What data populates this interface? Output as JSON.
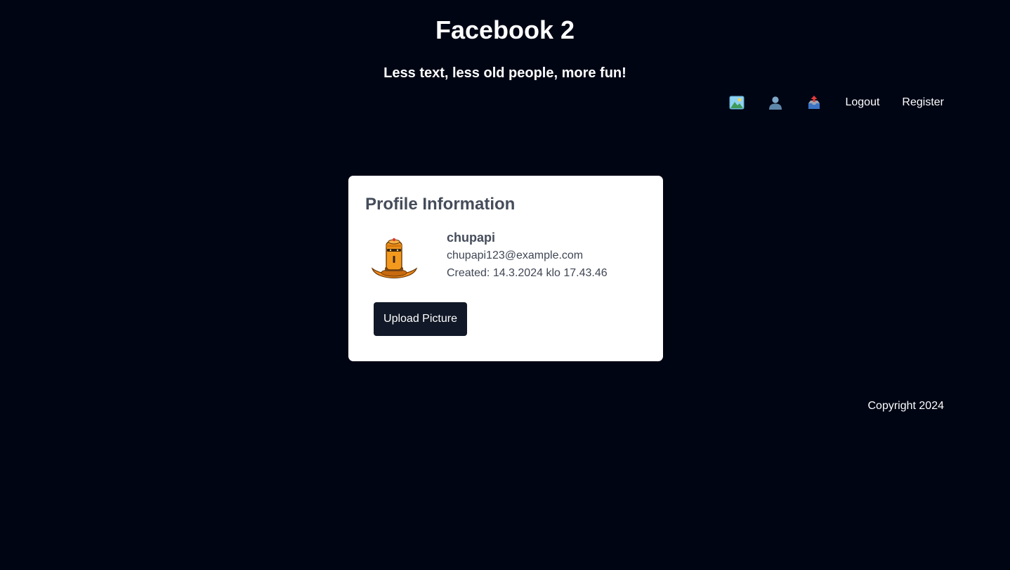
{
  "header": {
    "title": "Facebook 2",
    "tagline": "Less text, less old people, more fun!"
  },
  "nav": {
    "icons": [
      {
        "name": "picture-icon"
      },
      {
        "name": "user-icon"
      },
      {
        "name": "outbox-icon"
      }
    ],
    "links": [
      {
        "label": "Logout"
      },
      {
        "label": "Register"
      }
    ]
  },
  "profile": {
    "heading": "Profile Information",
    "username": "chupapi",
    "email": "chupapi123@example.com",
    "created": "Created: 14.3.2024 klo 17.43.46",
    "upload_label": "Upload Picture"
  },
  "footer": {
    "copyright": "Copyright 2024"
  },
  "colors": {
    "background": "#000514",
    "card": "#ffffff",
    "button": "#111827"
  }
}
